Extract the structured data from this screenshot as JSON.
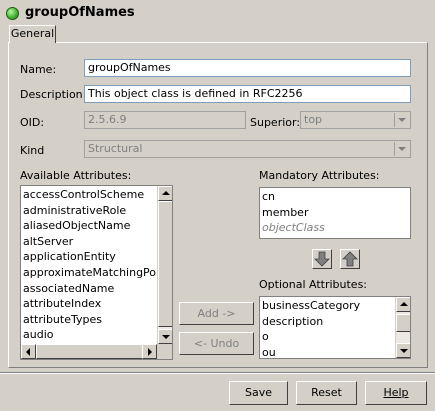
{
  "window": {
    "title": "groupOfNames"
  },
  "tabs": [
    {
      "label": "General"
    }
  ],
  "form": {
    "name_label": "Name:",
    "name_value": "groupOfNames",
    "description_label": "Description:",
    "description_value": "This object class is defined in RFC2256",
    "oid_label": "OID:",
    "oid_value": "2.5.6.9",
    "superior_label": "Superior:",
    "superior_value": "top",
    "kind_label": "Kind",
    "kind_value": "Structural"
  },
  "available": {
    "label": "Available Attributes:",
    "items": [
      "accessControlScheme",
      "administrativeRole",
      "aliasedObjectName",
      "altServer",
      "applicationEntity",
      "approximateMatchingPolicy",
      "associatedName",
      "attributeIndex",
      "attributeTypes",
      "audio"
    ]
  },
  "mandatory": {
    "label": "Mandatory Attributes:",
    "items": [
      {
        "text": "cn",
        "inherited": false
      },
      {
        "text": "member",
        "inherited": false
      },
      {
        "text": "objectClass",
        "inherited": true
      }
    ]
  },
  "optional": {
    "label": "Optional Attributes:",
    "items": [
      "businessCategory",
      "description",
      "o",
      "ou"
    ]
  },
  "actions": {
    "add_label": "Add ->",
    "undo_label": "<- Undo"
  },
  "footer": {
    "save_label": "Save",
    "reset_label": "Reset",
    "help_label": "Help"
  },
  "colors": {
    "background": "#d4d0c8",
    "disabled_text": "#808080",
    "field_border": "#7f9db9",
    "status_icon": "#3fae2b"
  },
  "icons": {
    "title": "green-circle-icon",
    "move_down": "arrow-down-icon",
    "move_up": "arrow-up-icon"
  }
}
